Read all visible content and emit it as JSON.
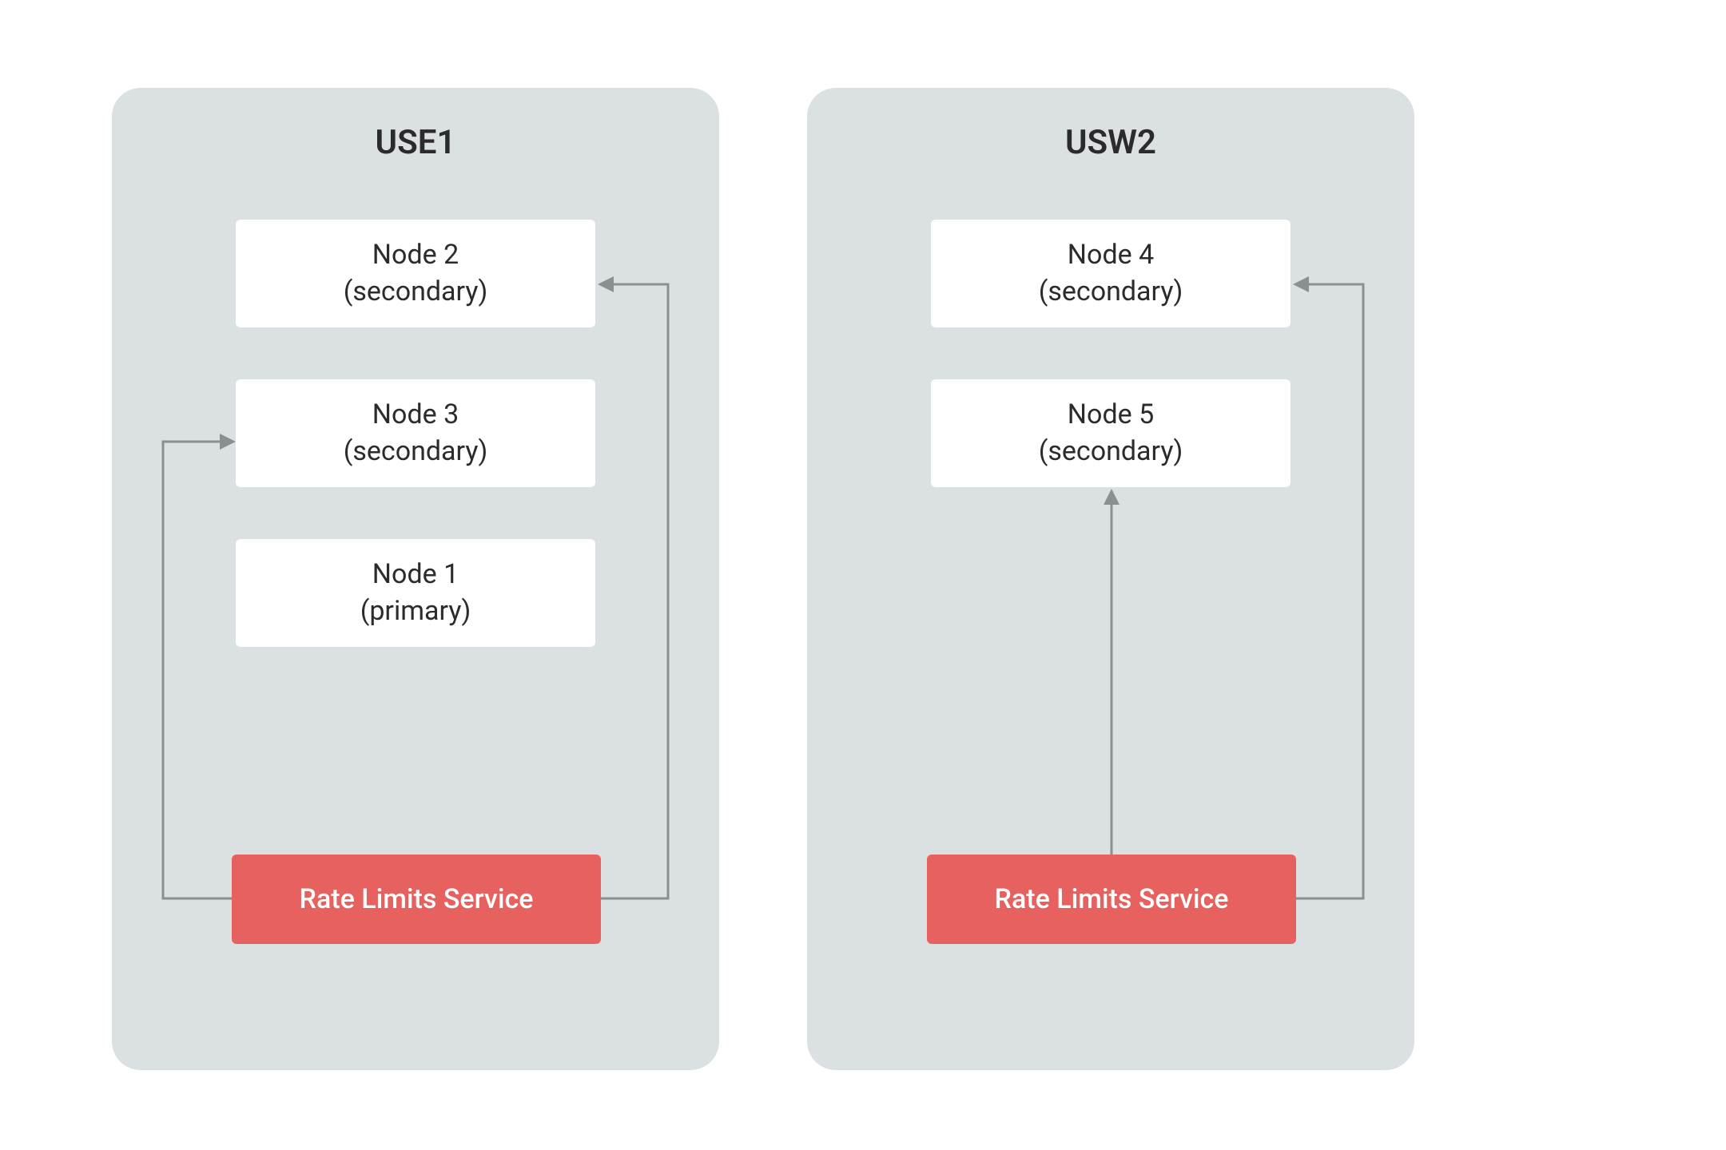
{
  "diagram": {
    "regions": [
      {
        "id": "use1",
        "title": "USE1",
        "nodes": [
          {
            "name": "Node 2",
            "role": "(secondary)"
          },
          {
            "name": "Node 3",
            "role": "(secondary)"
          },
          {
            "name": "Node 1",
            "role": "(primary)"
          }
        ],
        "service_label": "Rate Limits Service"
      },
      {
        "id": "usw2",
        "title": "USW2",
        "nodes": [
          {
            "name": "Node 4",
            "role": "(secondary)"
          },
          {
            "name": "Node 5",
            "role": "(secondary)"
          }
        ],
        "service_label": "Rate Limits Service"
      }
    ]
  },
  "colors": {
    "region_bg": "#dbe0e2",
    "node_bg": "#ffffff",
    "service_bg": "#e7625f",
    "service_fg": "#ffffff",
    "arrow": "#8a8f91",
    "text": "#2b2b2b"
  }
}
